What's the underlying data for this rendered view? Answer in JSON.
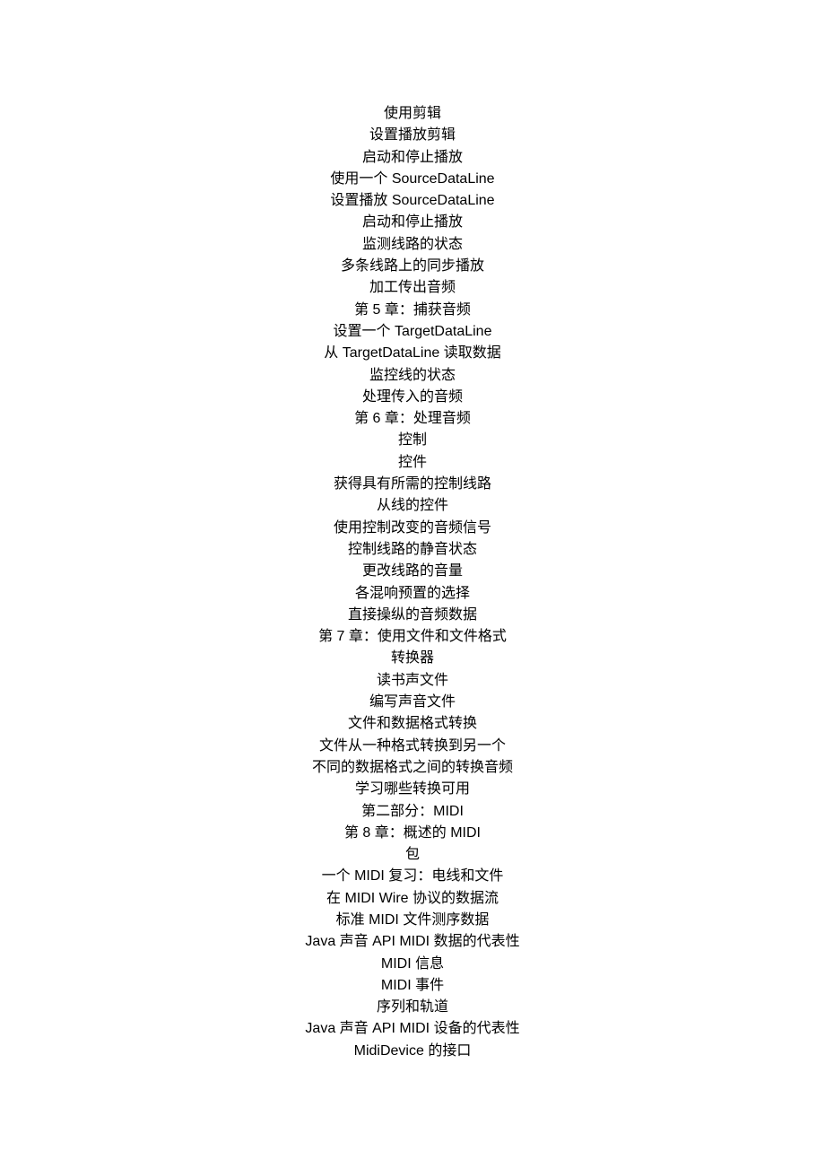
{
  "lines": [
    "使用剪辑",
    "设置播放剪辑",
    "启动和停止播放",
    "使用一个 SourceDataLine",
    "设置播放 SourceDataLine",
    "启动和停止播放",
    "监测线路的状态",
    "多条线路上的同步播放",
    "加工传出音频",
    "第 5 章：捕获音频",
    "设置一个 TargetDataLine",
    "从 TargetDataLine 读取数据",
    "监控线的状态",
    "处理传入的音频",
    "第 6 章：处理音频",
    "控制",
    "控件",
    "获得具有所需的控制线路",
    "从线的控件",
    "使用控制改变的音频信号",
    "控制线路的静音状态",
    "更改线路的音量",
    "各混响预置的选择",
    "直接操纵的音频数据",
    "第 7 章：使用文件和文件格式",
    "转换器",
    "读书声文件",
    "编写声音文件",
    "文件和数据格式转换",
    "文件从一种格式转换到另一个",
    "不同的数据格式之间的转换音频",
    "学习哪些转换可用",
    "第二部分：MIDI",
    "第 8 章：概述的 MIDI",
    "包",
    "一个 MIDI 复习：电线和文件",
    "在 MIDI Wire 协议的数据流",
    "标准 MIDI 文件测序数据",
    "Java 声音 API MIDI 数据的代表性",
    "MIDI 信息",
    "MIDI 事件",
    "序列和轨道",
    "Java 声音 API MIDI 设备的代表性",
    "MidiDevice 的接口"
  ]
}
